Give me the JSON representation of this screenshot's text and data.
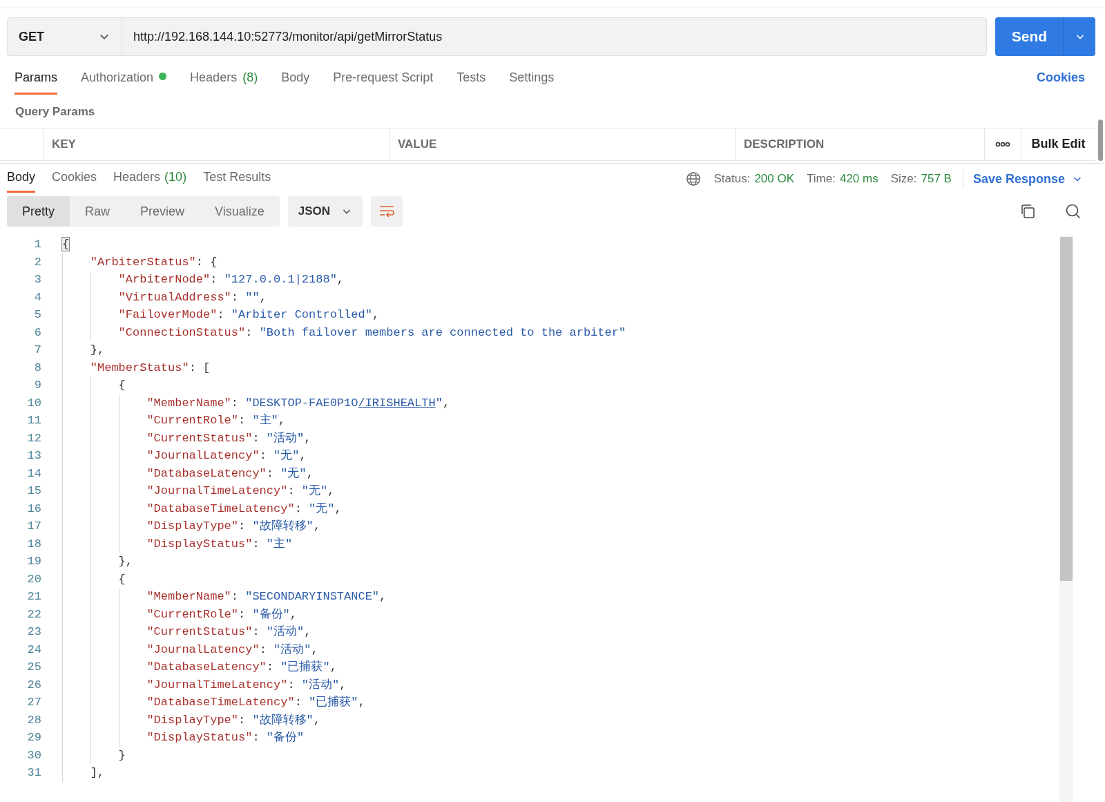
{
  "request": {
    "method": "GET",
    "url": "http://192.168.144.10:52773/monitor/api/getMirrorStatus",
    "send": "Send"
  },
  "request_tabs": [
    {
      "label": "Params",
      "selected": true
    },
    {
      "label": "Authorization",
      "selected": false,
      "status_dot": true
    },
    {
      "label": "Headers",
      "count": "(8)",
      "selected": false
    },
    {
      "label": "Body",
      "selected": false
    },
    {
      "label": "Pre-request Script",
      "selected": false
    },
    {
      "label": "Tests",
      "selected": false
    },
    {
      "label": "Settings",
      "selected": false
    }
  ],
  "cookies_link": "Cookies",
  "query_params": {
    "title": "Query Params",
    "columns": [
      "KEY",
      "VALUE",
      "DESCRIPTION"
    ],
    "bulk_edit": "Bulk Edit"
  },
  "response_tabs": [
    {
      "label": "Body",
      "selected": true
    },
    {
      "label": "Cookies",
      "selected": false
    },
    {
      "label": "Headers",
      "count": "(10)",
      "selected": false
    },
    {
      "label": "Test Results",
      "selected": false
    }
  ],
  "response_meta": {
    "status_label": "Status:",
    "status": "200 OK",
    "time_label": "Time:",
    "time": "420 ms",
    "size_label": "Size:",
    "size": "757 B",
    "save": "Save Response"
  },
  "view_modes": [
    {
      "label": "Pretty",
      "selected": true
    },
    {
      "label": "Raw",
      "selected": false
    },
    {
      "label": "Preview",
      "selected": false
    },
    {
      "label": "Visualize",
      "selected": false
    }
  ],
  "format": "JSON",
  "code_lines": [
    {
      "number": "1",
      "tokens": [
        {
          "kind": "punct",
          "text": "{",
          "matched": true
        }
      ],
      "children": [
        {
          "number": "2",
          "tokens": [
            {
              "kind": "key",
              "text": "\"ArbiterStatus\""
            },
            {
              "kind": "punct",
              "text": ": {"
            }
          ],
          "children": [
            {
              "number": "3",
              "tokens": [
                {
                  "kind": "key",
                  "text": "\"ArbiterNode\""
                },
                {
                  "kind": "punct",
                  "text": ": "
                },
                {
                  "kind": "string",
                  "text": "\"127.0.0.1|2188\""
                },
                {
                  "kind": "punct",
                  "text": ","
                }
              ]
            },
            {
              "number": "4",
              "tokens": [
                {
                  "kind": "key",
                  "text": "\"VirtualAddress\""
                },
                {
                  "kind": "punct",
                  "text": ": "
                },
                {
                  "kind": "string",
                  "text": "\"\""
                },
                {
                  "kind": "punct",
                  "text": ","
                }
              ]
            },
            {
              "number": "5",
              "tokens": [
                {
                  "kind": "key",
                  "text": "\"FailoverMode\""
                },
                {
                  "kind": "punct",
                  "text": ": "
                },
                {
                  "kind": "string",
                  "text": "\"Arbiter Controlled\""
                },
                {
                  "kind": "punct",
                  "text": ","
                }
              ]
            },
            {
              "number": "6",
              "tokens": [
                {
                  "kind": "key",
                  "text": "\"ConnectionStatus\""
                },
                {
                  "kind": "punct",
                  "text": ": "
                },
                {
                  "kind": "string",
                  "text": "\"Both failover members are connected to the arbiter\""
                }
              ]
            }
          ]
        },
        {
          "number": "7",
          "tokens": [
            {
              "kind": "punct",
              "text": "},"
            }
          ]
        },
        {
          "number": "8",
          "tokens": [
            {
              "kind": "key",
              "text": "\"MemberStatus\""
            },
            {
              "kind": "punct",
              "text": ": ["
            }
          ],
          "children": [
            {
              "number": "9",
              "tokens": [
                {
                  "kind": "punct",
                  "text": "{"
                }
              ],
              "children": [
                {
                  "number": "10",
                  "tokens": [
                    {
                      "kind": "key",
                      "text": "\"MemberName\""
                    },
                    {
                      "kind": "punct",
                      "text": ": "
                    },
                    {
                      "kind": "string",
                      "text": "\"DESKTOP-FAE0P1O"
                    },
                    {
                      "kind": "link",
                      "text": "/IRISHEALTH"
                    },
                    {
                      "kind": "string",
                      "text": "\""
                    },
                    {
                      "kind": "punct",
                      "text": ","
                    }
                  ]
                },
                {
                  "number": "11",
                  "tokens": [
                    {
                      "kind": "key",
                      "text": "\"CurrentRole\""
                    },
                    {
                      "kind": "punct",
                      "text": ": "
                    },
                    {
                      "kind": "string",
                      "text": "\"主\""
                    },
                    {
                      "kind": "punct",
                      "text": ","
                    }
                  ]
                },
                {
                  "number": "12",
                  "tokens": [
                    {
                      "kind": "key",
                      "text": "\"CurrentStatus\""
                    },
                    {
                      "kind": "punct",
                      "text": ": "
                    },
                    {
                      "kind": "string",
                      "text": "\"活动\""
                    },
                    {
                      "kind": "punct",
                      "text": ","
                    }
                  ]
                },
                {
                  "number": "13",
                  "tokens": [
                    {
                      "kind": "key",
                      "text": "\"JournalLatency\""
                    },
                    {
                      "kind": "punct",
                      "text": ": "
                    },
                    {
                      "kind": "string",
                      "text": "\"无\""
                    },
                    {
                      "kind": "punct",
                      "text": ","
                    }
                  ]
                },
                {
                  "number": "14",
                  "tokens": [
                    {
                      "kind": "key",
                      "text": "\"DatabaseLatency\""
                    },
                    {
                      "kind": "punct",
                      "text": ": "
                    },
                    {
                      "kind": "string",
                      "text": "\"无\""
                    },
                    {
                      "kind": "punct",
                      "text": ","
                    }
                  ]
                },
                {
                  "number": "15",
                  "tokens": [
                    {
                      "kind": "key",
                      "text": "\"JournalTimeLatency\""
                    },
                    {
                      "kind": "punct",
                      "text": ": "
                    },
                    {
                      "kind": "string",
                      "text": "\"无\""
                    },
                    {
                      "kind": "punct",
                      "text": ","
                    }
                  ]
                },
                {
                  "number": "16",
                  "tokens": [
                    {
                      "kind": "key",
                      "text": "\"DatabaseTimeLatency\""
                    },
                    {
                      "kind": "punct",
                      "text": ": "
                    },
                    {
                      "kind": "string",
                      "text": "\"无\""
                    },
                    {
                      "kind": "punct",
                      "text": ","
                    }
                  ]
                },
                {
                  "number": "17",
                  "tokens": [
                    {
                      "kind": "key",
                      "text": "\"DisplayType\""
                    },
                    {
                      "kind": "punct",
                      "text": ": "
                    },
                    {
                      "kind": "string",
                      "text": "\"故障转移\""
                    },
                    {
                      "kind": "punct",
                      "text": ","
                    }
                  ]
                },
                {
                  "number": "18",
                  "tokens": [
                    {
                      "kind": "key",
                      "text": "\"DisplayStatus\""
                    },
                    {
                      "kind": "punct",
                      "text": ": "
                    },
                    {
                      "kind": "string",
                      "text": "\"主\""
                    }
                  ]
                }
              ]
            },
            {
              "number": "19",
              "tokens": [
                {
                  "kind": "punct",
                  "text": "},"
                }
              ]
            },
            {
              "number": "20",
              "tokens": [
                {
                  "kind": "punct",
                  "text": "{"
                }
              ],
              "children": [
                {
                  "number": "21",
                  "tokens": [
                    {
                      "kind": "key",
                      "text": "\"MemberName\""
                    },
                    {
                      "kind": "punct",
                      "text": ": "
                    },
                    {
                      "kind": "string",
                      "text": "\"SECONDARYINSTANCE\""
                    },
                    {
                      "kind": "punct",
                      "text": ","
                    }
                  ]
                },
                {
                  "number": "22",
                  "tokens": [
                    {
                      "kind": "key",
                      "text": "\"CurrentRole\""
                    },
                    {
                      "kind": "punct",
                      "text": ": "
                    },
                    {
                      "kind": "string",
                      "text": "\"备份\""
                    },
                    {
                      "kind": "punct",
                      "text": ","
                    }
                  ]
                },
                {
                  "number": "23",
                  "tokens": [
                    {
                      "kind": "key",
                      "text": "\"CurrentStatus\""
                    },
                    {
                      "kind": "punct",
                      "text": ": "
                    },
                    {
                      "kind": "string",
                      "text": "\"活动\""
                    },
                    {
                      "kind": "punct",
                      "text": ","
                    }
                  ]
                },
                {
                  "number": "24",
                  "tokens": [
                    {
                      "kind": "key",
                      "text": "\"JournalLatency\""
                    },
                    {
                      "kind": "punct",
                      "text": ": "
                    },
                    {
                      "kind": "string",
                      "text": "\"活动\""
                    },
                    {
                      "kind": "punct",
                      "text": ","
                    }
                  ]
                },
                {
                  "number": "25",
                  "tokens": [
                    {
                      "kind": "key",
                      "text": "\"DatabaseLatency\""
                    },
                    {
                      "kind": "punct",
                      "text": ": "
                    },
                    {
                      "kind": "string",
                      "text": "\"已捕获\""
                    },
                    {
                      "kind": "punct",
                      "text": ","
                    }
                  ]
                },
                {
                  "number": "26",
                  "tokens": [
                    {
                      "kind": "key",
                      "text": "\"JournalTimeLatency\""
                    },
                    {
                      "kind": "punct",
                      "text": ": "
                    },
                    {
                      "kind": "string",
                      "text": "\"活动\""
                    },
                    {
                      "kind": "punct",
                      "text": ","
                    }
                  ]
                },
                {
                  "number": "27",
                  "tokens": [
                    {
                      "kind": "key",
                      "text": "\"DatabaseTimeLatency\""
                    },
                    {
                      "kind": "punct",
                      "text": ": "
                    },
                    {
                      "kind": "string",
                      "text": "\"已捕获\""
                    },
                    {
                      "kind": "punct",
                      "text": ","
                    }
                  ]
                },
                {
                  "number": "28",
                  "tokens": [
                    {
                      "kind": "key",
                      "text": "\"DisplayType\""
                    },
                    {
                      "kind": "punct",
                      "text": ": "
                    },
                    {
                      "kind": "string",
                      "text": "\"故障转移\""
                    },
                    {
                      "kind": "punct",
                      "text": ","
                    }
                  ]
                },
                {
                  "number": "29",
                  "tokens": [
                    {
                      "kind": "key",
                      "text": "\"DisplayStatus\""
                    },
                    {
                      "kind": "punct",
                      "text": ": "
                    },
                    {
                      "kind": "string",
                      "text": "\"备份\""
                    }
                  ]
                }
              ]
            },
            {
              "number": "30",
              "tokens": [
                {
                  "kind": "punct",
                  "text": "}"
                }
              ]
            }
          ]
        },
        {
          "number": "31",
          "tokens": [
            {
              "kind": "punct",
              "text": "],"
            }
          ]
        }
      ]
    }
  ]
}
